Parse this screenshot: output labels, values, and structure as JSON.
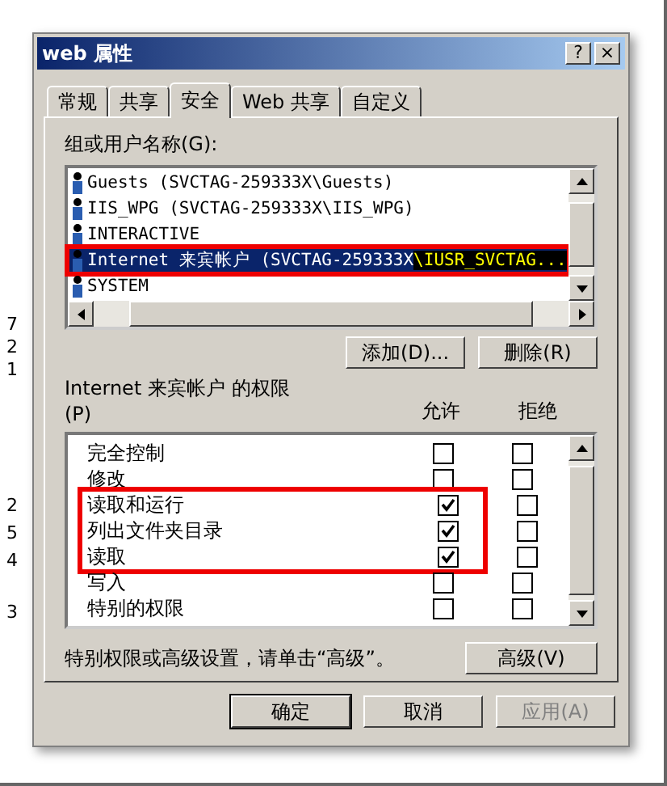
{
  "background_fragments": [
    "7",
    "2",
    "1",
    "2",
    "5",
    "4",
    "3"
  ],
  "window": {
    "title": "web 属性",
    "help_button": "?",
    "close_button": "×"
  },
  "tabs": [
    {
      "label": "常规",
      "selected": false
    },
    {
      "label": "共享",
      "selected": false
    },
    {
      "label": "安全",
      "selected": true
    },
    {
      "label": "Web 共享",
      "selected": false
    },
    {
      "label": "自定义",
      "selected": false
    }
  ],
  "groups_label": "组或用户名称(G):",
  "users": [
    {
      "name": "Guests (SVCTAG-259333X\\Guests)",
      "selected": false,
      "annotated": false
    },
    {
      "name": "IIS_WPG (SVCTAG-259333X\\IIS_WPG)",
      "selected": false,
      "annotated": false
    },
    {
      "name": "INTERACTIVE",
      "selected": false,
      "annotated": false
    },
    {
      "name": "Internet 来宾帐户 (SVCTAG-259333X",
      "highlight": "\\IUSR_SVCTAG...",
      "selected": true,
      "annotated": true
    },
    {
      "name": "SYSTEM",
      "selected": false,
      "annotated": false
    }
  ],
  "user_buttons": [
    "添加(D)...",
    "删除(R)"
  ],
  "permissions_label": "Internet 来宾帐户 的权限\n(P)",
  "columns": [
    "允许",
    "拒绝"
  ],
  "permissions": [
    {
      "name": "完全控制",
      "allow": false,
      "deny": false,
      "annotated": false
    },
    {
      "name": "修改",
      "allow": false,
      "deny": false,
      "annotated": false
    },
    {
      "name": "读取和运行",
      "allow": true,
      "deny": false,
      "annotated": true
    },
    {
      "name": "列出文件夹目录",
      "allow": true,
      "deny": false,
      "annotated": true
    },
    {
      "name": "读取",
      "allow": true,
      "deny": false,
      "annotated": true
    },
    {
      "name": "写入",
      "allow": false,
      "deny": false,
      "annotated": false
    },
    {
      "name": "特别的权限",
      "allow": false,
      "deny": false,
      "annotated": false
    }
  ],
  "advanced_hint": "特别权限或高级设置，请单击“高级”。",
  "advanced_button": "高级(V)",
  "buttons": [
    {
      "label": "确定",
      "disabled": false,
      "default": true
    },
    {
      "label": "取消",
      "disabled": false,
      "default": false
    },
    {
      "label": "应用(A)",
      "disabled": true,
      "default": false
    }
  ]
}
